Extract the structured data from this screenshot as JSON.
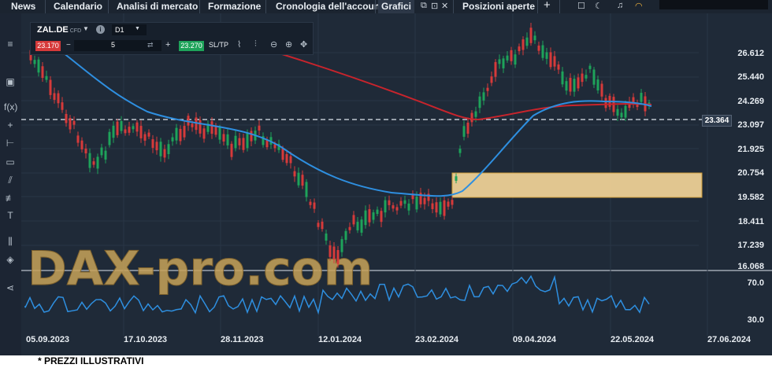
{
  "nav": {
    "tabs": [
      {
        "label": "News"
      },
      {
        "label": "Calendario"
      },
      {
        "label": "Analisi di mercato"
      },
      {
        "label": "Formazione"
      },
      {
        "label": "Cronologia dell'account"
      },
      {
        "label": "Grafici"
      },
      {
        "label": "Posizioni aperte"
      }
    ],
    "add_tab": "+"
  },
  "toolbar": {
    "symbol": "ZAL.DE",
    "symbol_type": "CFD",
    "timeframe": "D1",
    "sell_price": "23.170",
    "buy_price": "23.270",
    "quantity": "5",
    "minus": "−",
    "plus": "+",
    "sltp_label": "SL/TP"
  },
  "chart": {
    "current_price": "23.364",
    "price_axis": [
      "26.612",
      "25.440",
      "24.269",
      "23.097",
      "21.925",
      "20.754",
      "19.582",
      "18.411",
      "17.239",
      "16.068"
    ],
    "indicator_axis": [
      "70.0",
      "30.0"
    ],
    "date_axis": [
      "05.09.2023",
      "17.10.2023",
      "28.11.2023",
      "12.01.2024",
      "23.02.2024",
      "09.04.2024",
      "22.05.2024",
      "27.06.2024"
    ],
    "watermark": "DAX-pro.com",
    "colors": {
      "background": "#1f2a38",
      "ma_long": "#c8242c",
      "ma_short": "#2e8fe0",
      "rsi": "#2e8fe0",
      "zone": "#f7d79a",
      "up": "#1ea35a",
      "down": "#d63a3a"
    }
  },
  "footnote": "* PREZZI ILLUSTRATIVI"
}
